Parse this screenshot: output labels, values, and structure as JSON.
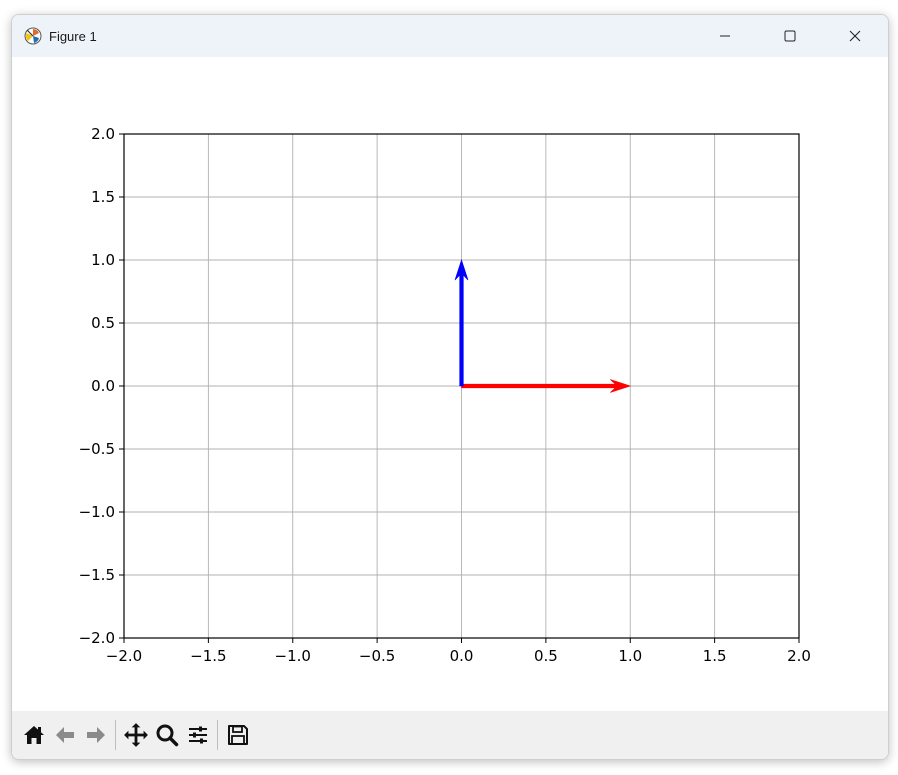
{
  "window": {
    "title": "Figure 1"
  },
  "icons": {
    "app": "matplotlib-icon",
    "minimize": "minimize-icon",
    "maximize": "maximize-icon",
    "close": "close-icon"
  },
  "toolbar": {
    "buttons": [
      "home-icon",
      "back-icon",
      "forward-icon",
      "pan-icon",
      "zoom-icon",
      "configure-subplots-icon",
      "save-icon"
    ]
  },
  "chart_data": {
    "type": "quiver",
    "xlim": [
      -2.0,
      2.0
    ],
    "ylim": [
      -2.0,
      2.0
    ],
    "xticks": [
      "−2.0",
      "−1.5",
      "−1.0",
      "−0.5",
      "0.0",
      "0.5",
      "1.0",
      "1.5",
      "2.0"
    ],
    "yticks": [
      "−2.0",
      "−1.5",
      "−1.0",
      "−0.5",
      "0.0",
      "0.5",
      "1.0",
      "1.5",
      "2.0"
    ],
    "grid": true,
    "vectors": [
      {
        "origin": [
          0,
          0
        ],
        "components": [
          1,
          0
        ],
        "color": "#ff0000"
      },
      {
        "origin": [
          0,
          0
        ],
        "components": [
          0,
          1
        ],
        "color": "#0000ff"
      }
    ]
  }
}
